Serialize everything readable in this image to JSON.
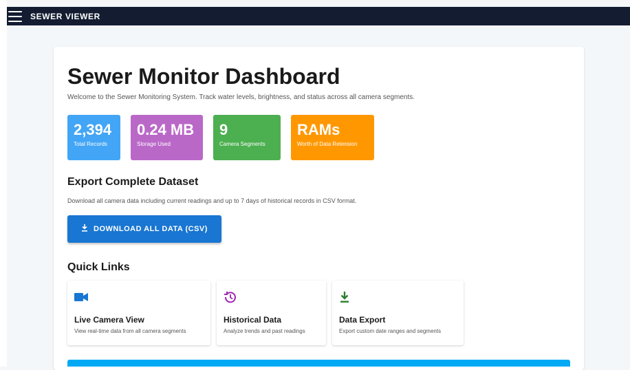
{
  "appbar": {
    "brand": "SEWER VIEWER"
  },
  "dashboard": {
    "title": "Sewer Monitor Dashboard",
    "welcome": "Welcome to the Sewer Monitoring System. Track water levels, brightness, and status across all camera segments."
  },
  "stats": [
    {
      "value": "2,394",
      "label": "Total Records",
      "color": "#42a5f5"
    },
    {
      "value": "0.24 MB",
      "label": "Storage Used",
      "color": "#ba68c8"
    },
    {
      "value": "9",
      "label": "Camera Segments",
      "color": "#4caf50"
    },
    {
      "value": "RAMs",
      "label": "Worth of Data Retension",
      "color": "#ff9800"
    }
  ],
  "export": {
    "title": "Export Complete Dataset",
    "description": "Download all camera data including current readings and up to 7 days of historical records in CSV format.",
    "button_label": "DOWNLOAD ALL DATA (CSV)"
  },
  "quick_links": {
    "title": "Quick Links",
    "items": [
      {
        "title": "Live Camera View",
        "description": "View real-time data from all camera segments",
        "icon": "video-camera-icon",
        "icon_color": "#1976d2"
      },
      {
        "title": "Historical Data",
        "description": "Analyze trends and past readings",
        "icon": "history-icon",
        "icon_color": "#9c27b0"
      },
      {
        "title": "Data Export",
        "description": "Export custom date ranges and segments",
        "icon": "download-icon",
        "icon_color": "#2e7d32"
      }
    ]
  },
  "colors": {
    "appbar": "#131c31",
    "bottom_bar": "#03a9f4",
    "primary": "#1976d2"
  }
}
